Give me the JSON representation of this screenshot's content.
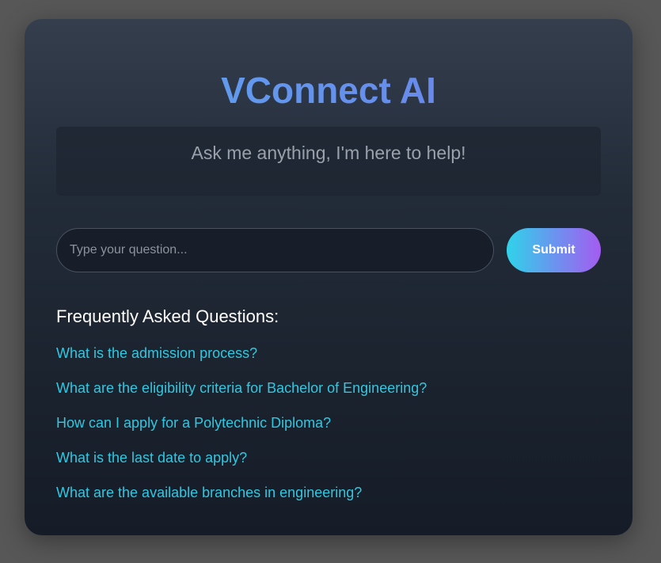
{
  "app": {
    "title": "VConnect AI"
  },
  "chat": {
    "greeting": "Ask me anything, I'm here to help!"
  },
  "input": {
    "value": "",
    "placeholder": "Type your question..."
  },
  "submit": {
    "label": "Submit"
  },
  "faq": {
    "heading": "Frequently Asked Questions:",
    "items": [
      {
        "label": "What is the admission process?"
      },
      {
        "label": "What are the eligibility criteria for Bachelor of Engineering?"
      },
      {
        "label": "How can I apply for a Polytechnic Diploma?"
      },
      {
        "label": "What is the last date to apply?"
      },
      {
        "label": "What are the available branches in engineering?"
      }
    ]
  },
  "colors": {
    "title_gradient_start": "#5aa9f0",
    "title_gradient_end": "#6f7be8",
    "button_gradient_start": "#2fd3ea",
    "button_gradient_end": "#a45cf0",
    "faq_link": "#32c7e0"
  }
}
